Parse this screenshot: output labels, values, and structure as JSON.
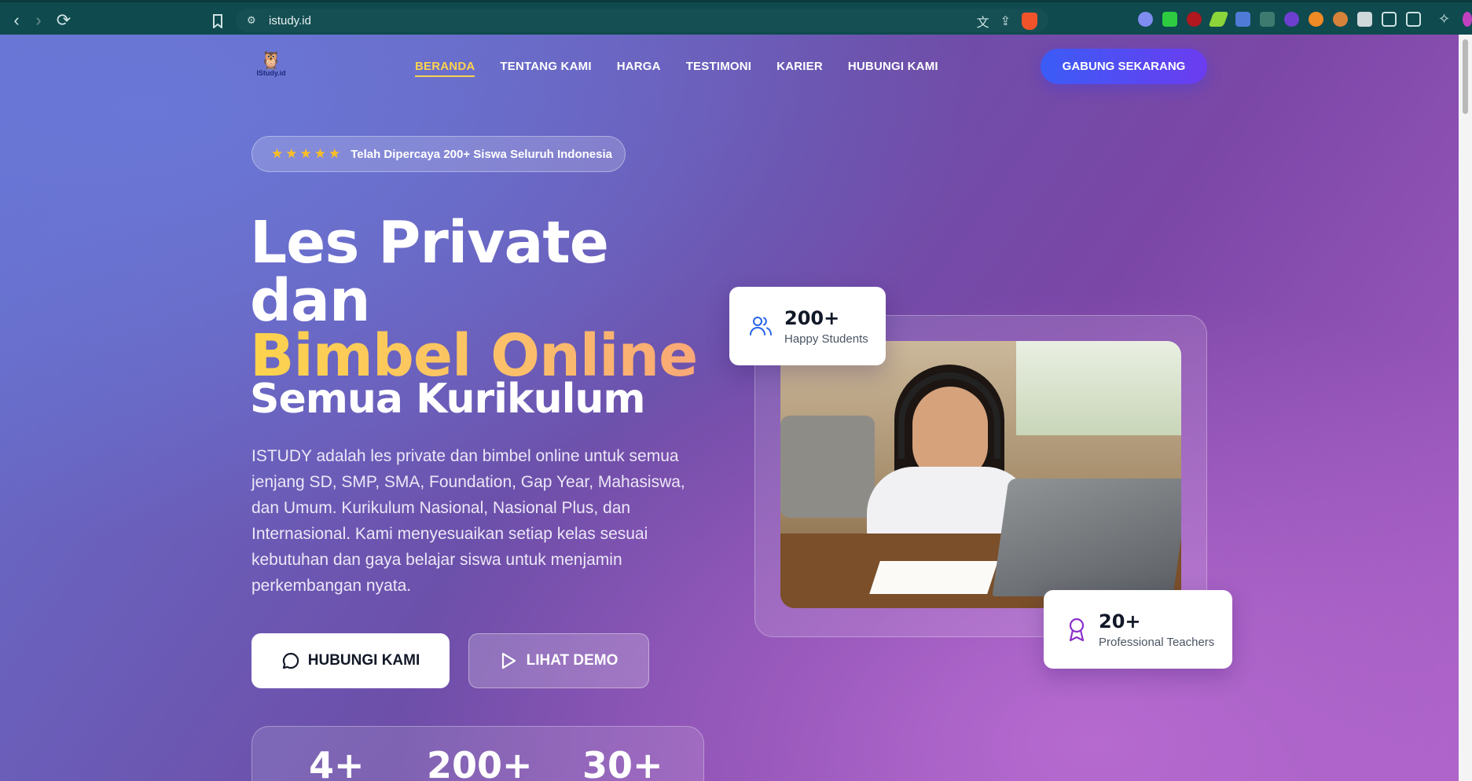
{
  "browser": {
    "url": "istudy.id"
  },
  "nav": {
    "logo_text": "IStudy.id",
    "items": [
      {
        "label": "BERANDA",
        "active": true
      },
      {
        "label": "TENTANG KAMI"
      },
      {
        "label": "HARGA"
      },
      {
        "label": "TESTIMONI"
      },
      {
        "label": "KARIER"
      },
      {
        "label": "HUBUNGI KAMI"
      }
    ],
    "cta": "GABUNG SEKARANG"
  },
  "hero": {
    "trust_badge": "Telah Dipercaya 200+ Siswa Seluruh Indonesia",
    "rating_stars": 5,
    "title_line1": "Les Private",
    "title_line2": "dan",
    "title_line3": "Bimbel Online",
    "title_line4": "Semua Kurikulum",
    "description": "ISTUDY adalah les private dan bimbel online untuk semua jenjang SD, SMP, SMA, Foundation, Gap Year, Mahasiswa, dan Umum. Kurikulum Nasional, Nasional Plus, dan Internasional. Kami menyesuaikan setiap kelas sesuai kebutuhan dan gaya belajar siswa untuk menjamin perkembangan nyata.",
    "btn_contact": "HUBUNGI KAMI",
    "btn_demo": "LIHAT DEMO",
    "stats": [
      "4+",
      "200+",
      "30+"
    ]
  },
  "cards": {
    "students_num": "200+",
    "students_label": "Happy Students",
    "teachers_num": "20+",
    "teachers_label": "Professional Teachers"
  },
  "colors": {
    "accent_yellow": "#fcd34d",
    "cta_blue": "#3b5cf6",
    "cta_purple": "#6b3cf0",
    "chrome_teal": "#0f4a4e"
  }
}
